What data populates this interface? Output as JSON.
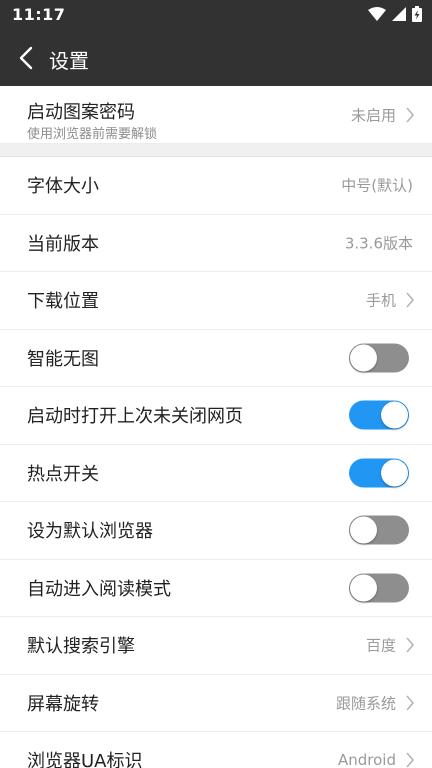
{
  "status_bar": {
    "time": "11:17"
  },
  "toolbar": {
    "title": "设置"
  },
  "pattern_lock": {
    "label": "启动图案密码",
    "sub": "使用浏览器前需要解锁",
    "value": "未启用"
  },
  "settings": {
    "font_size": {
      "label": "字体大小",
      "value": "中号(默认)"
    },
    "version": {
      "label": "当前版本",
      "value": "3.3.6版本"
    },
    "download_location": {
      "label": "下载位置",
      "value": "手机"
    },
    "smart_no_image": {
      "label": "智能无图",
      "on": false
    },
    "restore_tabs": {
      "label": "启动时打开上次未关闭网页",
      "on": true
    },
    "hotspot": {
      "label": "热点开关",
      "on": true
    },
    "default_browser": {
      "label": "设为默认浏览器",
      "on": false
    },
    "auto_reader": {
      "label": "自动进入阅读模式",
      "on": false
    },
    "search_engine": {
      "label": "默认搜索引擎",
      "value": "百度"
    },
    "screen_rotation": {
      "label": "屏幕旋转",
      "value": "跟随系统"
    },
    "ua": {
      "label": "浏览器UA标识",
      "value": "Android"
    }
  },
  "colors": {
    "toggle_on": "#2196f3",
    "toggle_off": "#8e8e8e",
    "bar": "#323232"
  }
}
